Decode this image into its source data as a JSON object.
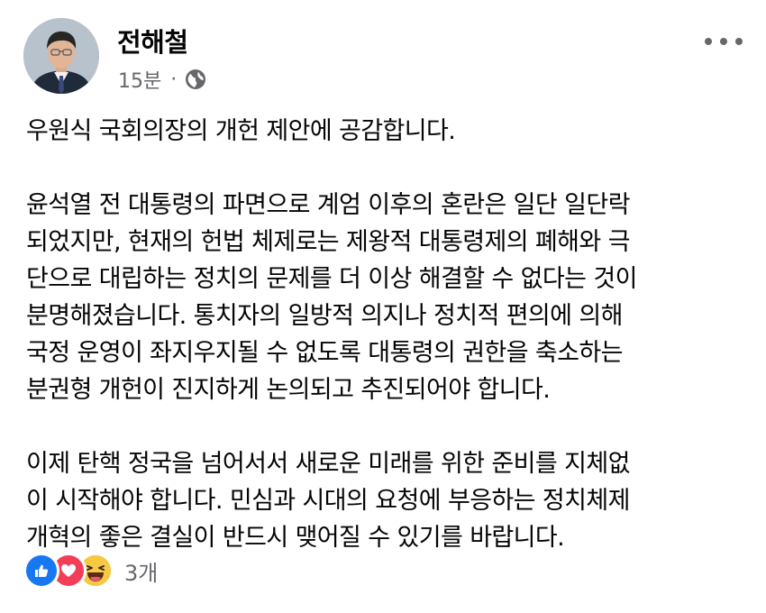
{
  "post": {
    "author": {
      "name": "전해철"
    },
    "timestamp": "15분",
    "separator": "·",
    "privacy_icon": "globe-icon",
    "more_icon": "more-horizontal-icon",
    "paragraphs": [
      {
        "lines": [
          "우원식 국회의장의 개헌 제안에 공감합니다."
        ]
      },
      {
        "lines": [
          "윤석열 전 대통령의 파면으로 계엄 이후의 혼란은 일단 일단락",
          "되었지만, 현재의 헌법 체제로는 제왕적 대통령제의 폐해와 극",
          "단으로 대립하는 정치의 문제를 더 이상 해결할 수 없다는 것이",
          "분명해졌습니다. 통치자의 일방적 의지나 정치적 편의에 의해",
          "국정 운영이 좌지우지될 수 없도록 대통령의 권한을 축소하는",
          "분권형 개헌이 진지하게 논의되고 추진되어야 합니다."
        ]
      },
      {
        "lines": [
          "이제 탄핵 정국을 넘어서서 새로운 미래를 위한 준비를 지체없",
          "이 시작해야 합니다. 민심과 시대의 요청에 부응하는 정치체제",
          "개혁의 좋은 결실이 반드시 맺어질 수 있기를 바랍니다."
        ]
      }
    ],
    "reactions": {
      "icons": [
        "like-icon",
        "love-icon",
        "haha-icon"
      ],
      "count": "3개"
    }
  },
  "colors": {
    "text": "#050505",
    "secondary_text": "#65676b",
    "like": "#1877f2",
    "love": "#f33e58",
    "haha": "#f7b125"
  }
}
